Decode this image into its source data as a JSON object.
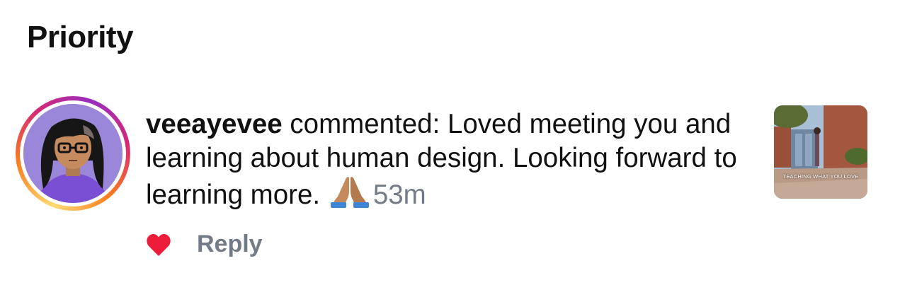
{
  "section": {
    "title": "Priority"
  },
  "notification": {
    "username": "veeayevee",
    "action": "commented:",
    "comment_text": "Loved meeting you and learning about human design. Looking forward to learning more.",
    "emoji": "folded-hands-emoji",
    "time": "53m",
    "thumbnail_caption": "TEACHING WHAT YOU LOVE",
    "liked": true,
    "reply_label": "Reply"
  },
  "colors": {
    "heart": "#ed1c3a",
    "muted_text": "#737b86",
    "ring_start": "#feda75",
    "ring_mid": "#d62976",
    "ring_end": "#962fbf"
  }
}
